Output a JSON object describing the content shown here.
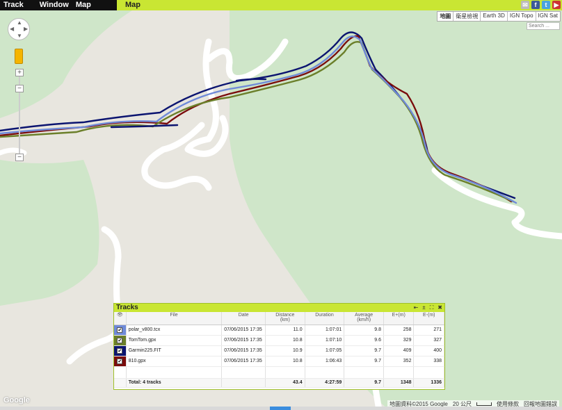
{
  "menu": {
    "items": [
      "Track",
      "Window",
      "Map"
    ],
    "active_tab": "Map"
  },
  "top_icons": [
    {
      "name": "mail-icon",
      "glyph": "✉",
      "color": "#bbbbbb"
    },
    {
      "name": "facebook-icon",
      "glyph": "f",
      "color": "#3b5998"
    },
    {
      "name": "twitter-icon",
      "glyph": "t",
      "color": "#4aa3df"
    },
    {
      "name": "youtube-icon",
      "glyph": "▶",
      "color": "#cc3333"
    }
  ],
  "map_types": [
    "地圖",
    "衛星檢視",
    "Earth 3D",
    "IGN Topo",
    "IGN Sat"
  ],
  "map_search_placeholder": "Search ...",
  "zoom": {
    "plus": "+",
    "minus": "−",
    "minus2": "−"
  },
  "google_logo": "Google",
  "attribution": {
    "data": "地圖資料©2015 Google",
    "scale": "20 公尺",
    "terms": "使用條款",
    "report": "回報地圖錯誤"
  },
  "track_colors": {
    "polar": "#6f8ad8",
    "tomtom": "#6b7f2a",
    "garmin": "#0b1470",
    "edge": "#7a0c0c"
  },
  "tracks_panel": {
    "title": "Tracks",
    "controls": [
      "⇤",
      "±",
      "⛶",
      "✖"
    ],
    "columns": [
      "File",
      "Date",
      "Distance\n(km)",
      "Duration",
      "Average\n(km/h)",
      "E+(m)",
      "E-(m)"
    ],
    "rows": [
      {
        "file": "polar_v800.tcx",
        "date": "07/06/2015 17:35",
        "distance": "11.0",
        "duration": "1:07:01",
        "average": "9.8",
        "eplus": "258",
        "eminus": "271",
        "color": "#6f8ad8",
        "checked": "✔"
      },
      {
        "file": "TomTom.gpx",
        "date": "07/06/2015 17:35",
        "distance": "10.8",
        "duration": "1:07:10",
        "average": "9.6",
        "eplus": "329",
        "eminus": "327",
        "color": "#6b7f2a",
        "checked": "✔"
      },
      {
        "file": "Garmin225.FIT",
        "date": "07/06/2015 17:35",
        "distance": "10.9",
        "duration": "1:07:05",
        "average": "9.7",
        "eplus": "409",
        "eminus": "400",
        "color": "#0b1470",
        "checked": "✔"
      },
      {
        "file": "810.gpx",
        "date": "07/06/2015 17:35",
        "distance": "10.8",
        "duration": "1:06:43",
        "average": "9.7",
        "eplus": "352",
        "eminus": "338",
        "color": "#7a0c0c",
        "checked": "✔"
      }
    ],
    "total": {
      "label": "Total: 4 tracks",
      "distance": "43.4",
      "duration": "4:27:59",
      "average": "9.7",
      "eplus": "1348",
      "eminus": "1336"
    }
  }
}
